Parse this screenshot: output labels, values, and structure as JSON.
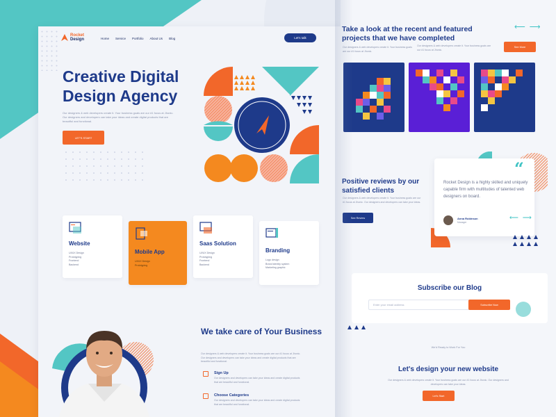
{
  "brand": {
    "line1": "Rocket",
    "line2": "Design"
  },
  "nav": {
    "items": [
      "Home",
      "Service",
      "Portfolio",
      "About Us",
      "Blog"
    ],
    "cta": "Let's talk"
  },
  "hero": {
    "title": "Creative Digital Design Agency",
    "text": "Our designers & web developers create it. Your business goals are our #1 focus at Jhonic. Our designers and developers can take your ideas and create digital products that are beautiful and functional.",
    "button": "LET'S START"
  },
  "services": [
    {
      "title": "Website",
      "lines": [
        "UI/UX Design",
        "Prototyping",
        "Frontend",
        "Backend"
      ],
      "active": false
    },
    {
      "title": "Mobile App",
      "lines": [
        "UI/UX Design",
        "Prototyping"
      ],
      "active": true
    },
    {
      "title": "Saas Solution",
      "lines": [
        "UI/UX Design",
        "Prototyping",
        "Frontend",
        "Backend"
      ],
      "active": false
    },
    {
      "title": "Branding",
      "lines": [
        "Logo design",
        "Brand identity system",
        "Marketing graphic"
      ],
      "active": false
    }
  ],
  "care": {
    "title": "We take care of Your Business",
    "text": "Our designers & web developers create it. Your business goals are our #1 focus at Jhonic. Our designers and developers can take your ideas and create digital products that are beautiful and functional.",
    "features": [
      {
        "title": "Sign Up",
        "text": "Our designers and developers can take your ideas and create digital products that are beautiful and functional."
      },
      {
        "title": "Choose Categories",
        "text": "Our designers and developers can take your ideas and create digital products that are beautiful and functional."
      }
    ]
  },
  "projects": {
    "title": "Take a look at the recent and featured projects that we have completed",
    "text": "Our designers & web developers create it. Your business goals are our #1 focus at Jhonic.",
    "text2": "Our designers & web developers create it. Your business goals are our #1 focus at Jhonic.",
    "button": "See More"
  },
  "reviews": {
    "title": "Positive reviews by our satisfied clients",
    "text": "Our designers & web developers create it. Your business goals are our #1 focus at Jhonic. Our designers and developers can take your ideas.",
    "button": "See Review",
    "quote": "Rocket Design is a highly skilled and uniquely capable firm with multitudes of talented web designers on board.",
    "reviewer_name": "Anna Robinson",
    "reviewer_role": "Manager"
  },
  "subscribe": {
    "title": "Subscribe our Blog",
    "placeholder": "Enter your email address",
    "button": "Subscribe Now"
  },
  "cta": {
    "pre": "We'd Ready to Work For You",
    "title": "Let's design your new website",
    "text": "Our designers & web developers create it. Your business goals are our #1 focus at Jhonic. Our designers and developers can take your ideas.",
    "button": "Let's Start"
  },
  "colors": {
    "navy": "#1e3a8a",
    "orange": "#f2672a",
    "teal": "#3fc3c4",
    "amber": "#f4891f"
  }
}
